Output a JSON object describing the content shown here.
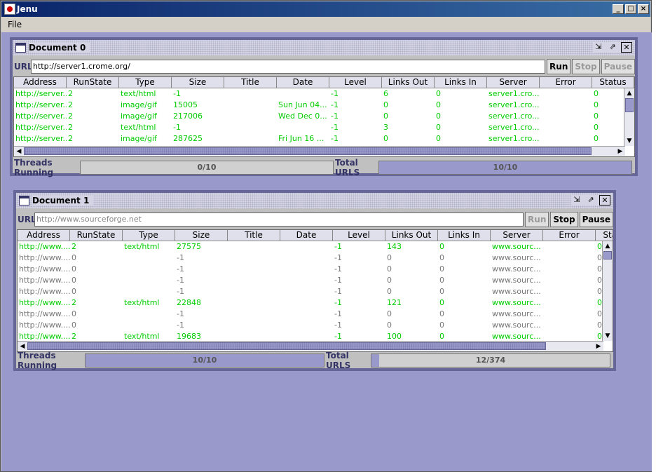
{
  "app": {
    "title": "Jenu",
    "menu": [
      "File"
    ],
    "window_buttons": [
      "_",
      "□",
      "×"
    ]
  },
  "columns": [
    "Address",
    "RunState",
    "Type",
    "Size",
    "Title",
    "Date",
    "Level",
    "Links Out",
    "Links In",
    "Server",
    "Error",
    "Status"
  ],
  "doc0": {
    "title": "Document 0",
    "url_label": "URL:",
    "url": "http://server1.crome.org/",
    "buttons": {
      "run": "Run",
      "stop": "Stop",
      "pause": "Pause"
    },
    "rows": [
      [
        "http://server...",
        "2",
        "text/html",
        "-1",
        "",
        "",
        "-1",
        "6",
        "0",
        "server1.cro...",
        "",
        "0"
      ],
      [
        "http://server...",
        "2",
        "image/gif",
        "15005",
        "",
        "Sun Jun 04...",
        "-1",
        "0",
        "0",
        "server1.cro...",
        "",
        "0"
      ],
      [
        "http://server...",
        "2",
        "image/gif",
        "217006",
        "",
        "Wed Dec 0...",
        "-1",
        "0",
        "0",
        "server1.cro...",
        "",
        "0"
      ],
      [
        "http://server...",
        "2",
        "text/html",
        "-1",
        "",
        "",
        "-1",
        "3",
        "0",
        "server1.cro...",
        "",
        "0"
      ],
      [
        "http://server...",
        "2",
        "image/gif",
        "287625",
        "",
        "Fri Jun 16 ...",
        "-1",
        "0",
        "0",
        "server1.cro...",
        "",
        "0"
      ]
    ],
    "threads_label": "Threads Running",
    "threads_value": "0/10",
    "threads_fraction": 0.0,
    "total_label": "Total URLS",
    "total_value": "10/10",
    "total_fraction": 1.0
  },
  "doc1": {
    "title": "Document 1",
    "url_label": "URL:",
    "url_placeholder": "http://www.sourceforge.net",
    "buttons": {
      "run": "Run",
      "stop": "Stop",
      "pause": "Pause"
    },
    "rows": [
      [
        "http://www....",
        "2",
        "text/html",
        "27575",
        "",
        "",
        "-1",
        "143",
        "0",
        "www.sourc...",
        "",
        "0",
        "green"
      ],
      [
        "http://www....",
        "0",
        "",
        "-1",
        "",
        "",
        "-1",
        "0",
        "0",
        "www.sourc...",
        "",
        "0",
        "gray"
      ],
      [
        "http://www....",
        "0",
        "",
        "-1",
        "",
        "",
        "-1",
        "0",
        "0",
        "www.sourc...",
        "",
        "0",
        "gray"
      ],
      [
        "http://www....",
        "0",
        "",
        "-1",
        "",
        "",
        "-1",
        "0",
        "0",
        "www.sourc...",
        "",
        "0",
        "gray"
      ],
      [
        "http://www....",
        "0",
        "",
        "-1",
        "",
        "",
        "-1",
        "0",
        "0",
        "www.sourc...",
        "",
        "0",
        "gray"
      ],
      [
        "http://www....",
        "2",
        "text/html",
        "22848",
        "",
        "",
        "-1",
        "121",
        "0",
        "www.sourc...",
        "",
        "0",
        "green"
      ],
      [
        "http://www....",
        "0",
        "",
        "-1",
        "",
        "",
        "-1",
        "0",
        "0",
        "www.sourc...",
        "",
        "0",
        "gray"
      ],
      [
        "http://www....",
        "0",
        "",
        "-1",
        "",
        "",
        "-1",
        "0",
        "0",
        "www.sourc...",
        "",
        "0",
        "gray"
      ],
      [
        "http://www....",
        "2",
        "text/html",
        "19683",
        "",
        "",
        "-1",
        "100",
        "0",
        "www.sourc...",
        "",
        "0",
        "green"
      ]
    ],
    "threads_label": "Threads Running",
    "threads_value": "10/10",
    "threads_fraction": 1.0,
    "total_label": "Total URLS",
    "total_value": "12/374",
    "total_fraction": 0.032
  },
  "colors": {
    "desktop": "#9999cc",
    "running": "#00cc00",
    "idle": "#777777",
    "frame_border": "#666699"
  }
}
